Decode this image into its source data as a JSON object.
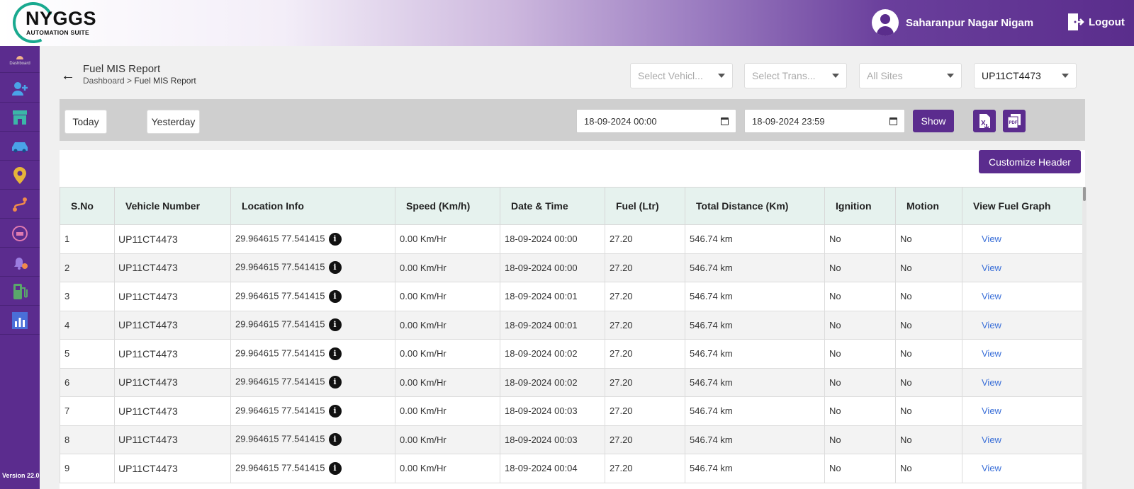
{
  "header": {
    "logo_title": "NYGGS",
    "logo_sub": "AUTOMATION SUITE",
    "user_name": "Saharanpur Nagar Nigam",
    "logout_label": "Logout"
  },
  "sidebar": {
    "dashboard_label": "Dashboard",
    "version": "Version 22.0",
    "items": [
      "user-add-icon",
      "store-icon",
      "car-icon",
      "location-pin-icon",
      "route-icon",
      "vehicle-sync-icon",
      "alarm-settings-icon",
      "fuel-pump-icon",
      "report-chart-icon"
    ]
  },
  "page": {
    "title": "Fuel MIS Report",
    "breadcrumb_root": "Dashboard",
    "breadcrumb_sep": " > ",
    "breadcrumb_current": "Fuel MIS Report"
  },
  "filters": {
    "vehicle_type_placeholder": "Select Vehicl...",
    "transporter_placeholder": "Select Trans...",
    "sites_placeholder": "All Sites",
    "vehicle_selected": "UP11CT4473",
    "today_label": "Today",
    "yesterday_label": "Yesterday",
    "from_datetime": "18-09-2024 00:00",
    "to_datetime": "18-09-2024 23:59",
    "show_label": "Show",
    "excel_icon": "excel-export-icon",
    "pdf_icon": "pdf-export-icon"
  },
  "table": {
    "customize_label": "Customize Header",
    "columns": [
      "S.No",
      "Vehicle Number",
      "Location Info",
      "Speed (Km/h)",
      "Date & Time",
      "Fuel (Ltr)",
      "Total Distance (Km)",
      "Ignition",
      "Motion",
      "View Fuel Graph"
    ],
    "rows": [
      {
        "sno": "1",
        "vehicle": "UP11CT4473",
        "location": "29.964615 77.541415",
        "speed": "0.00 Km/Hr",
        "datetime": "18-09-2024 00:00",
        "fuel": "27.20",
        "distance": "546.74 km",
        "ignition": "No",
        "motion": "No",
        "view": "View"
      },
      {
        "sno": "2",
        "vehicle": "UP11CT4473",
        "location": "29.964615 77.541415",
        "speed": "0.00 Km/Hr",
        "datetime": "18-09-2024 00:00",
        "fuel": "27.20",
        "distance": "546.74 km",
        "ignition": "No",
        "motion": "No",
        "view": "View"
      },
      {
        "sno": "3",
        "vehicle": "UP11CT4473",
        "location": "29.964615 77.541415",
        "speed": "0.00 Km/Hr",
        "datetime": "18-09-2024 00:01",
        "fuel": "27.20",
        "distance": "546.74 km",
        "ignition": "No",
        "motion": "No",
        "view": "View"
      },
      {
        "sno": "4",
        "vehicle": "UP11CT4473",
        "location": "29.964615 77.541415",
        "speed": "0.00 Km/Hr",
        "datetime": "18-09-2024 00:01",
        "fuel": "27.20",
        "distance": "546.74 km",
        "ignition": "No",
        "motion": "No",
        "view": "View"
      },
      {
        "sno": "5",
        "vehicle": "UP11CT4473",
        "location": "29.964615 77.541415",
        "speed": "0.00 Km/Hr",
        "datetime": "18-09-2024 00:02",
        "fuel": "27.20",
        "distance": "546.74 km",
        "ignition": "No",
        "motion": "No",
        "view": "View"
      },
      {
        "sno": "6",
        "vehicle": "UP11CT4473",
        "location": "29.964615 77.541415",
        "speed": "0.00 Km/Hr",
        "datetime": "18-09-2024 00:02",
        "fuel": "27.20",
        "distance": "546.74 km",
        "ignition": "No",
        "motion": "No",
        "view": "View"
      },
      {
        "sno": "7",
        "vehicle": "UP11CT4473",
        "location": "29.964615 77.541415",
        "speed": "0.00 Km/Hr",
        "datetime": "18-09-2024 00:03",
        "fuel": "27.20",
        "distance": "546.74 km",
        "ignition": "No",
        "motion": "No",
        "view": "View"
      },
      {
        "sno": "8",
        "vehicle": "UP11CT4473",
        "location": "29.964615 77.541415",
        "speed": "0.00 Km/Hr",
        "datetime": "18-09-2024 00:03",
        "fuel": "27.20",
        "distance": "546.74 km",
        "ignition": "No",
        "motion": "No",
        "view": "View"
      },
      {
        "sno": "9",
        "vehicle": "UP11CT4473",
        "location": "29.964615 77.541415",
        "speed": "0.00 Km/Hr",
        "datetime": "18-09-2024 00:04",
        "fuel": "27.20",
        "distance": "546.74 km",
        "ignition": "No",
        "motion": "No",
        "view": "View"
      }
    ]
  },
  "colors": {
    "brand_purple": "#5b2c8e",
    "logo_teal": "#19a98f",
    "header_row": "#e6f2ee",
    "link_blue": "#3a6fd8"
  }
}
